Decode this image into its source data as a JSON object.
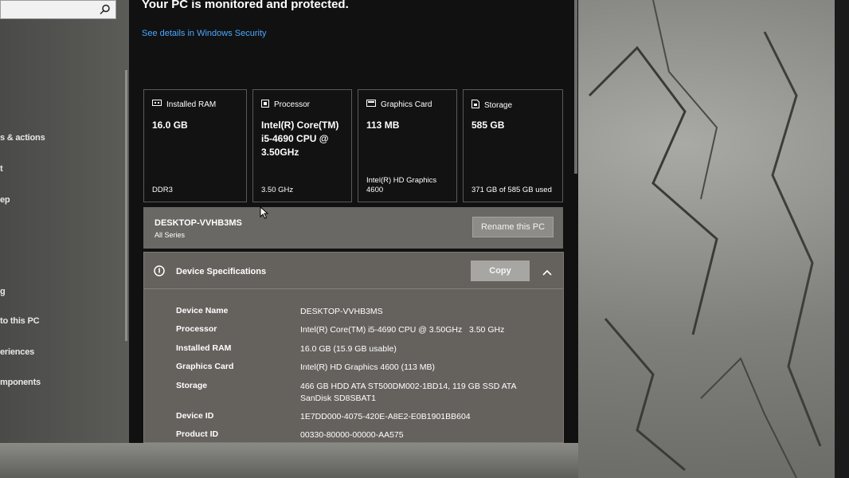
{
  "sidebar": {
    "search_placeholder": "",
    "items": [
      {
        "label": "s & actions"
      },
      {
        "label": "t"
      },
      {
        "label": "ep"
      },
      {
        "label": "g"
      },
      {
        "label": "to this PC"
      },
      {
        "label": "eriences"
      },
      {
        "label": "mponents"
      }
    ]
  },
  "main": {
    "headline": "Your PC is monitored and protected.",
    "security_link": "See details in Windows Security",
    "cards": [
      {
        "title": "Installed RAM",
        "value": "16.0 GB",
        "detail": "DDR3",
        "icon": "ram-icon"
      },
      {
        "title": "Processor",
        "value": "Intel(R) Core(TM) i5-4690 CPU @ 3.50GHz",
        "detail": "3.50 GHz",
        "icon": "processor-icon"
      },
      {
        "title": "Graphics Card",
        "value": "113 MB",
        "detail": "Intel(R) HD Graphics 4600",
        "icon": "graphics-card-icon"
      },
      {
        "title": "Storage",
        "value": "585 GB",
        "detail": "371 GB of 585 GB used",
        "icon": "storage-icon"
      }
    ],
    "pc": {
      "name": "DESKTOP-VVHB3MS",
      "edition": "All Series",
      "rename_label": "Rename this PC"
    },
    "specs": {
      "title": "Device Specifications",
      "copy_label": "Copy",
      "rows": [
        {
          "key": "Device Name",
          "value": "DESKTOP-VVHB3MS"
        },
        {
          "key": "Processor",
          "value": "Intel(R) Core(TM) i5-4690 CPU @ 3.50GHz   3.50 GHz"
        },
        {
          "key": "Installed RAM",
          "value": "16.0 GB (15.9 GB usable)"
        },
        {
          "key": "Graphics Card",
          "value": "Intel(R) HD Graphics 4600 (113 MB)"
        },
        {
          "key": "Storage",
          "value": "466 GB HDD ATA ST500DM002-1BD14, 119 GB SSD ATA",
          "value2": "SanDisk SD8SBAT1"
        },
        {
          "key": "Device ID",
          "value": "1E7DD000-4075-420E-A8E2-E0B1901BB604"
        },
        {
          "key": "Product ID",
          "value": "00330-80000-00000-AA575"
        }
      ]
    }
  },
  "colors": {
    "link": "#4aa8ff",
    "pane_bg": "#111111",
    "panel_bg": "#65625e"
  }
}
